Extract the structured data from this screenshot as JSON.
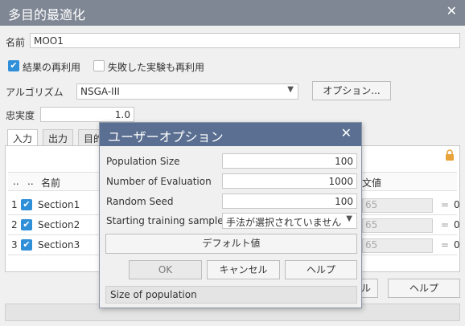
{
  "main": {
    "title": "多目的最適化",
    "name_label": "名前",
    "name_value": "MOO1",
    "reuse_results_label": "結果の再利用",
    "reuse_failed_label": "失敗した実験も再利用",
    "algorithm_label": "アルゴリズム",
    "algorithm_value": "NSGA-III",
    "options_button": "オプション...",
    "fidelity_label": "忠実度",
    "fidelity_value": "1.0",
    "tabs": [
      "入力",
      "出力",
      "目的"
    ],
    "table": {
      "col_dots": "..",
      "col_dots2": "..",
      "col_name": "名前",
      "col_value": "文値",
      "rows": [
        {
          "index": "1",
          "name": "Section1",
          "value": "65",
          "eq": "=",
          "zero": "0"
        },
        {
          "index": "2",
          "name": "Section2",
          "value": "65",
          "eq": "=",
          "zero": "0"
        },
        {
          "index": "3",
          "name": "Section3",
          "value": "65",
          "eq": "=",
          "zero": "0"
        }
      ]
    },
    "partial_button": "ル",
    "help_button": "ヘルプ"
  },
  "dialog": {
    "title": "ユーザーオプション",
    "population_label": "Population Size",
    "population_value": "100",
    "evaluation_label": "Number of Evaluation",
    "evaluation_value": "1000",
    "seed_label": "Random Seed",
    "seed_value": "100",
    "starting_label": "Starting training samples",
    "starting_value": "手法が選択されていません",
    "default_button": "デフォルト値",
    "ok_button": "OK",
    "cancel_button": "キャンセル",
    "help_button": "ヘルプ",
    "status": "Size of population"
  },
  "colors": {
    "titlebar": "#7f8794",
    "dialog_titlebar": "#5a6f91",
    "checkbox": "#2f8fd8",
    "lock": "#e8a33a"
  },
  "icons": {
    "close": "close-icon",
    "lock": "lock-icon",
    "dropdown": "chevron-down-icon"
  }
}
